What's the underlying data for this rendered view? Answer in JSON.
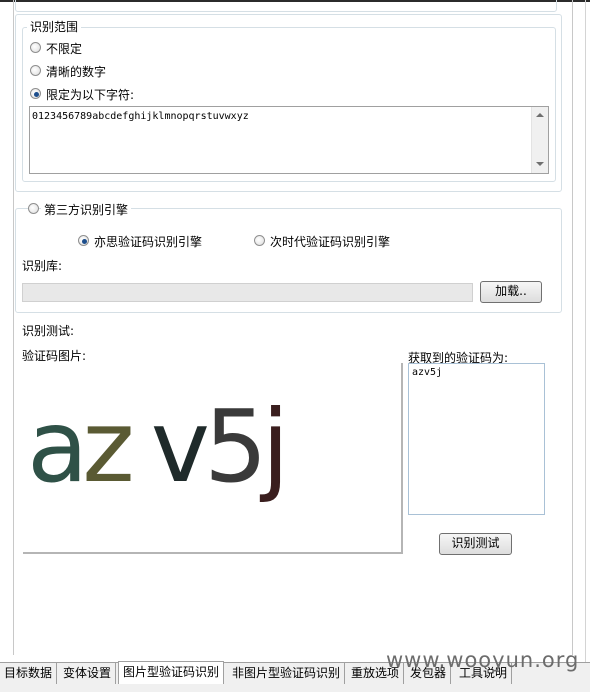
{
  "scope": {
    "legend": "识别范围",
    "options": [
      {
        "label": "不限定",
        "checked": false
      },
      {
        "label": "清晰的数字",
        "checked": false
      },
      {
        "label": "限定为以下字符:",
        "checked": true
      }
    ],
    "chars_value": "0123456789abcdefghijklmnopqrstuvwxyz"
  },
  "third_party": {
    "legend": "第三方识别引擎",
    "engine_options": [
      {
        "label": "亦思验证码识别引擎",
        "checked": true
      },
      {
        "label": "次时代验证码识别引擎",
        "checked": false
      }
    ],
    "library_label": "识别库:",
    "library_path": "",
    "load_button": "加载.."
  },
  "test": {
    "title": "识别测试:",
    "image_label": "验证码图片:",
    "captcha_chars": [
      {
        "ch": "a",
        "color": "#2f5147"
      },
      {
        "ch": "z",
        "color": "#5a5a33"
      },
      {
        "ch": "v",
        "color": "#1f2a2a"
      },
      {
        "ch": "5",
        "color": "#3a3a3a"
      },
      {
        "ch": "j",
        "color": "#3a1e1e"
      }
    ],
    "result_label": "获取到的验证码为:",
    "result_value": "azv5j",
    "test_button": "识别测试"
  },
  "tabs": [
    {
      "label": "目标数据",
      "active": false
    },
    {
      "label": "变体设置",
      "active": false
    },
    {
      "label": "图片型验证码识别",
      "active": true
    },
    {
      "label": "非图片型验证码识别",
      "active": false
    },
    {
      "label": "重放选项",
      "active": false
    },
    {
      "label": "发包器",
      "active": false
    },
    {
      "label": "工具说明",
      "active": false
    }
  ],
  "watermark": "www.wooyun.org"
}
